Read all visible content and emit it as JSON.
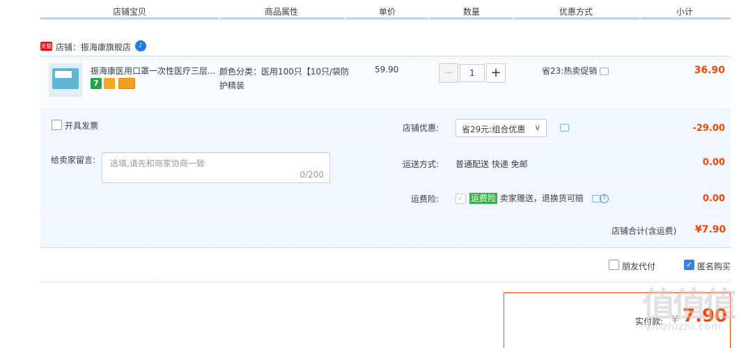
{
  "header": {
    "columns": [
      "店铺宝贝",
      "商品属性",
      "单价",
      "数量",
      "优惠方式",
      "小计"
    ]
  },
  "shop": {
    "badge": "天猫",
    "name": "店铺：振海康旗舰店",
    "ww_icon": "wangwang-chat-icon"
  },
  "item": {
    "title": "振海康医用口罩一次性医疗三层...",
    "props": "颜色分类：医用100只【10只/袋防护精装",
    "price": "59.90",
    "quantity": "1",
    "minus": "−",
    "plus": "+",
    "promo": "省23:热卖促销",
    "subtotal": "36.90"
  },
  "order": {
    "invoice_label": "开具发票",
    "memo_label": "给卖家留言:",
    "memo_placeholder": "选填,请先和商家协商一致",
    "memo_count": "0/200",
    "shop_discount_label": "店铺优惠:",
    "shop_discount_value": "省29元:组合优惠",
    "shop_discount_amount": "-29.00",
    "shipping_label": "运送方式:",
    "shipping_value": "普通配送 快递 免邮",
    "shipping_amount": "0.00",
    "insurance_label": "运费险:",
    "insurance_tag": "运费险",
    "insurance_text": "卖家赠送，退换货可赔",
    "insurance_amount": "0.00",
    "total_label": "店铺合计(含运费)",
    "total_value": "¥7.90"
  },
  "options": {
    "friend_pay": "朋友代付",
    "anonymous": "匿名购买"
  },
  "payment": {
    "label": "实付款:",
    "currency": "¥",
    "amount": "7.90"
  },
  "watermark": {
    "text": "值值值",
    "url": "zhizhizhi.com"
  },
  "colors": {
    "accent": "#f40",
    "header_border": "#b2d1ff",
    "panel_bg": "#f2f7ff",
    "tmall_red": "#e4131b"
  }
}
